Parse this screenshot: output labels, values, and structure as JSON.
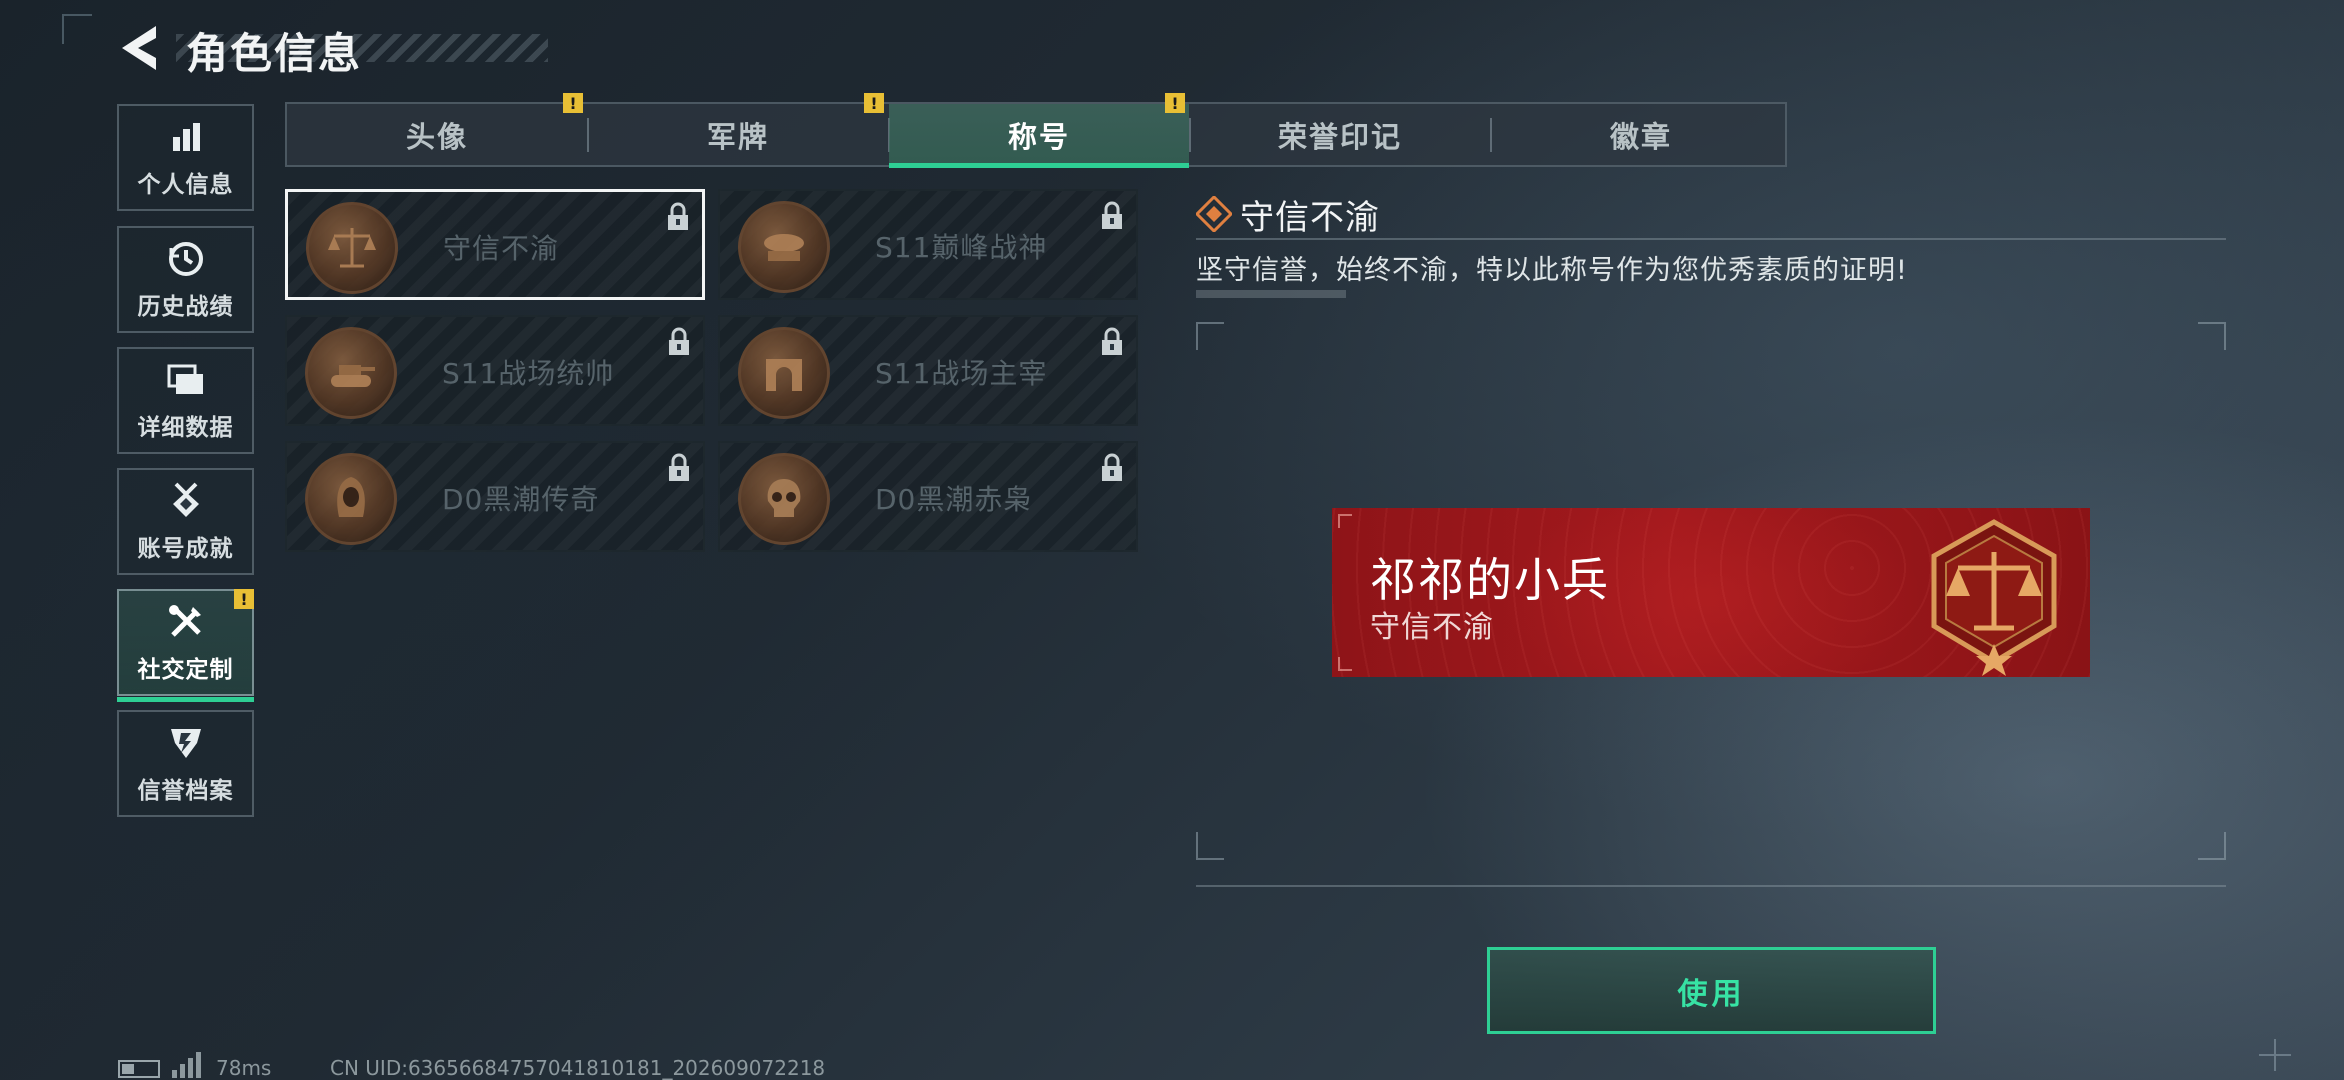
{
  "header": {
    "title": "角色信息"
  },
  "sidebar": {
    "items": [
      {
        "label": "个人信息",
        "icon": "bar-chart-icon"
      },
      {
        "label": "历史战绩",
        "icon": "history-clock-icon"
      },
      {
        "label": "详细数据",
        "icon": "folder-stack-icon"
      },
      {
        "label": "账号成就",
        "icon": "medal-icon"
      },
      {
        "label": "社交定制",
        "icon": "tools-icon",
        "badge": "!"
      },
      {
        "label": "信誉档案",
        "icon": "shield-emblem-icon"
      }
    ],
    "active_index": 4
  },
  "tabs": [
    {
      "label": "头像",
      "badge": "!"
    },
    {
      "label": "军牌",
      "badge": "!"
    },
    {
      "label": "称号",
      "badge": "!"
    },
    {
      "label": "荣誉印记"
    },
    {
      "label": "徽章"
    }
  ],
  "active_tab": 2,
  "titles": [
    {
      "name": "守信不渝",
      "emblem": "scales-emblem-icon",
      "locked": true,
      "selected": true
    },
    {
      "name": "S11巅峰战神",
      "emblem": "airship-emblem-icon",
      "locked": true
    },
    {
      "name": "S11战场统帅",
      "emblem": "tank-emblem-icon",
      "locked": true
    },
    {
      "name": "S11战场主宰",
      "emblem": "arch-emblem-icon",
      "locked": true
    },
    {
      "name": "D0黑潮传奇",
      "emblem": "hooded-figure-emblem-icon",
      "locked": true
    },
    {
      "name": "D0黑潮赤枭",
      "emblem": "skull-emblem-icon",
      "locked": true
    }
  ],
  "detail": {
    "title": "守信不渝",
    "description": "坚守信誉，始终不渝，特以此称号作为您优秀素质的证明!",
    "preview": {
      "player_name": "祁祁的小兵",
      "title": "守信不渝"
    },
    "use_button": "使用"
  },
  "footer": {
    "ping": "78ms",
    "uid": "CN UID:6365668475704181018​1_202609072218"
  },
  "colors": {
    "accent_green": "#2ecf94",
    "warning_yellow": "#e8bf35",
    "banner_red": "#a3191d"
  }
}
